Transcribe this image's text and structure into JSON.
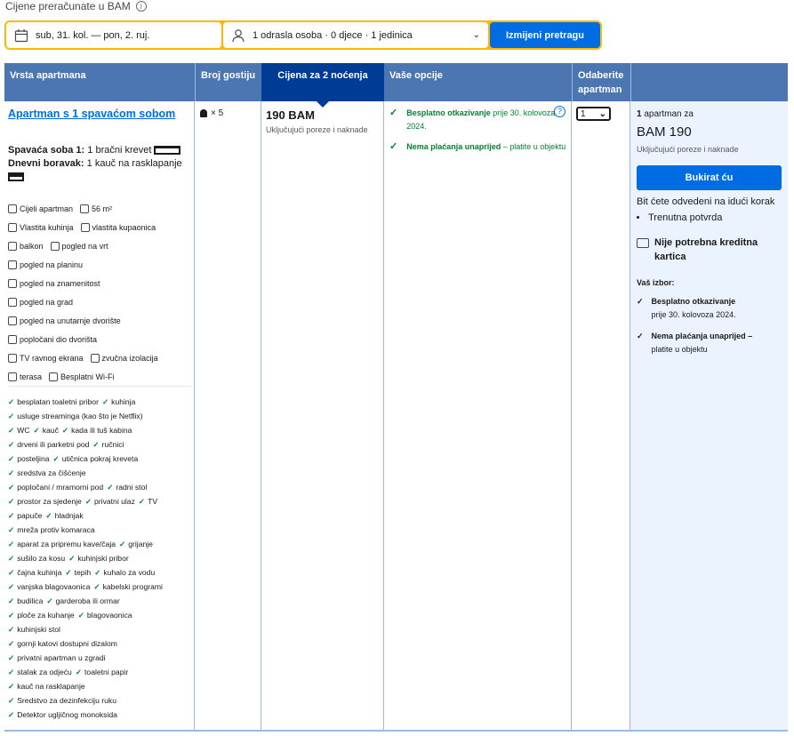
{
  "top_note": "Cijene preračunate u BAM",
  "search": {
    "dates": "sub, 31. kol. — pon, 2. ruj.",
    "guests": "1 odrasla osoba · 0 djece · 1 jedinica",
    "button": "Izmijeni pretragu"
  },
  "headers": {
    "type": "Vrsta apartmana",
    "guests": "Broj gostiju",
    "price": "Cijena za 2 noćenja",
    "options": "Vaše opcije",
    "select": "Odaberite apartman"
  },
  "room": {
    "title": "Apartman s 1 spavaćom sobom",
    "bedroom_label": "Spavaća soba 1:",
    "bedroom_value": "1 bračni krevet",
    "living_label": "Dnevni boravak:",
    "living_value": "1 kauč na rasklapanje",
    "facilities": [
      [
        "Cijeli apartman",
        "56 m²"
      ],
      [
        "Vlastita kuhinja",
        "vlastita kupaonica"
      ],
      [
        "balkon",
        "pogled na vrt"
      ],
      [
        "pogled na planinu"
      ],
      [
        "pogled na znamenitost"
      ],
      [
        "pogled na grad"
      ],
      [
        "pogled na unutarnje dvorište"
      ],
      [
        "popločani dio dvorišta"
      ],
      [
        "TV ravnog ekrana",
        "zvučna izolacija"
      ],
      [
        "terasa",
        "Besplatni Wi-Fi"
      ]
    ],
    "amenities": [
      [
        "besplatan toaletni pribor",
        "kuhinja"
      ],
      [
        "usluge streaminga (kao što je Netflix)"
      ],
      [
        "WC",
        "kauč",
        "kada ili tuš kabina"
      ],
      [
        "drveni ili parketni pod",
        "ručnici"
      ],
      [
        "posteljina",
        "utičnica pokraj kreveta"
      ],
      [
        "sredstva za čišćenje"
      ],
      [
        "popločani / mramorni pod",
        "radni stol"
      ],
      [
        "prostor za sjedenje",
        "privatni ulaz",
        "TV"
      ],
      [
        "papuče",
        "hladnjak"
      ],
      [
        "mreža protiv komaraca"
      ],
      [
        "aparat za pripremu kave/čaja",
        "grijanje"
      ],
      [
        "sušilo za kosu",
        "kuhinjski pribor"
      ],
      [
        "čajna kuhinja",
        "tepih",
        "kuhalo za vodu"
      ],
      [
        "vanjska blagovaonica",
        "kabelski programi"
      ],
      [
        "budilica",
        "garderoba ili ormar"
      ],
      [
        "ploče za kuhanje",
        "blagovaonica"
      ],
      [
        "kuhinjski stol"
      ],
      [
        "gornji katovi dostupni dizalom"
      ],
      [
        "privatni apartman u zgradi"
      ],
      [
        "stalak za odjeću",
        "toaletni papir"
      ],
      [
        "kauč na rasklapanje"
      ],
      [
        "Sredstvo za dezinfekciju ruku"
      ],
      [
        "Detektor ugljičnog monoksida"
      ]
    ]
  },
  "guests_count": "× 5",
  "price": {
    "amount": "190 BAM",
    "taxes": "Uključujući poreze i naknade"
  },
  "options": {
    "opt1_bold": "Besplatno otkazivanje",
    "opt1_rest": " prije 30. kolovoza 2024.",
    "opt2_bold": "Nema plaćanja unaprijed",
    "opt2_rest": " – platite u objektu",
    "help": "?"
  },
  "select_value": "1",
  "summary": {
    "count_num": "1",
    "count_text": " apartman za",
    "total": "BAM 190",
    "taxes": "Uključujući poreze i naknade",
    "book_button": "Bukirat ću",
    "next_step": "Bit ćete odvedeni na idući korak",
    "bullet": "Trenutna potvrda",
    "no_card": "Nije potrebna kreditna kartica",
    "choice_title": "Vaš izbor:",
    "ch1_bold": "Besplatno otkazivanje",
    "ch1_rest": "prije 30. kolovoza 2024.",
    "ch2_bold": "Nema plaćanja unaprijed –",
    "ch2_rest": "platite u objektu"
  },
  "colors": {
    "header": "#4c76b2",
    "price_header": "#003b95",
    "accent": "#006ce4",
    "search_border": "#ffb700",
    "green": "#008234",
    "side_bg": "#ebf3ff"
  }
}
